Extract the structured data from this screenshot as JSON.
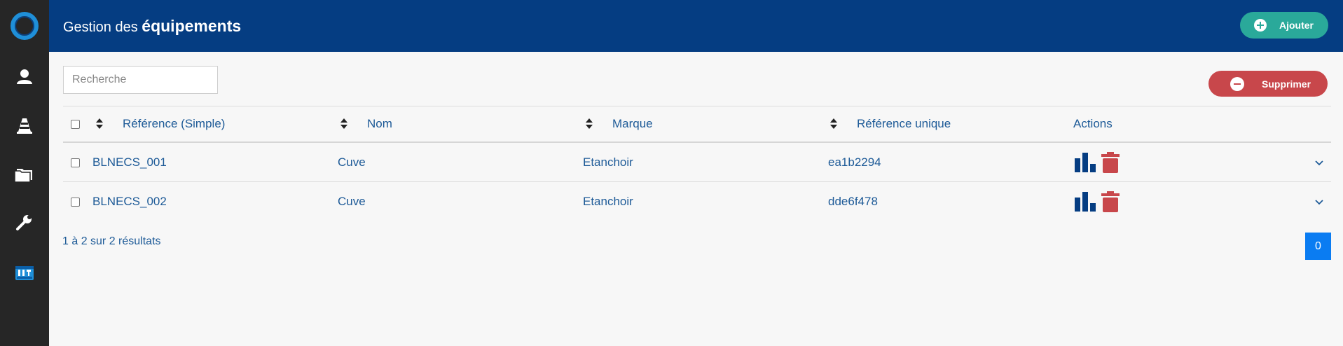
{
  "sidebar": {
    "items": [
      {
        "icon": "user-icon"
      },
      {
        "icon": "traffic-cone-icon"
      },
      {
        "icon": "folder-icon"
      },
      {
        "icon": "wrench-icon"
      },
      {
        "icon": "toolbox-icon"
      }
    ]
  },
  "header": {
    "title_prefix": "Gestion des",
    "title_bold": "équipements",
    "add_label": "Ajouter"
  },
  "search": {
    "placeholder": "Recherche"
  },
  "toolbar": {
    "delete_label": "Supprimer"
  },
  "table": {
    "columns": [
      "Référence (Simple)",
      "Nom",
      "Marque",
      "Référence unique",
      "Actions"
    ],
    "rows": [
      {
        "reference": "BLNECS_001",
        "nom": "Cuve",
        "marque": "Etanchoir",
        "ref_unique": "ea1b2294"
      },
      {
        "reference": "BLNECS_002",
        "nom": "Cuve",
        "marque": "Etanchoir",
        "ref_unique": "dde6f478"
      }
    ]
  },
  "footer": {
    "results_text": "1 à 2 sur 2 résultats",
    "page": "0"
  },
  "colors": {
    "header_bg": "#053d82",
    "sidebar_bg": "#262626",
    "add_button": "#2aa99a",
    "delete_button": "#c8474b",
    "link_text": "#1d5a97",
    "page_button": "#0a7cf2"
  }
}
